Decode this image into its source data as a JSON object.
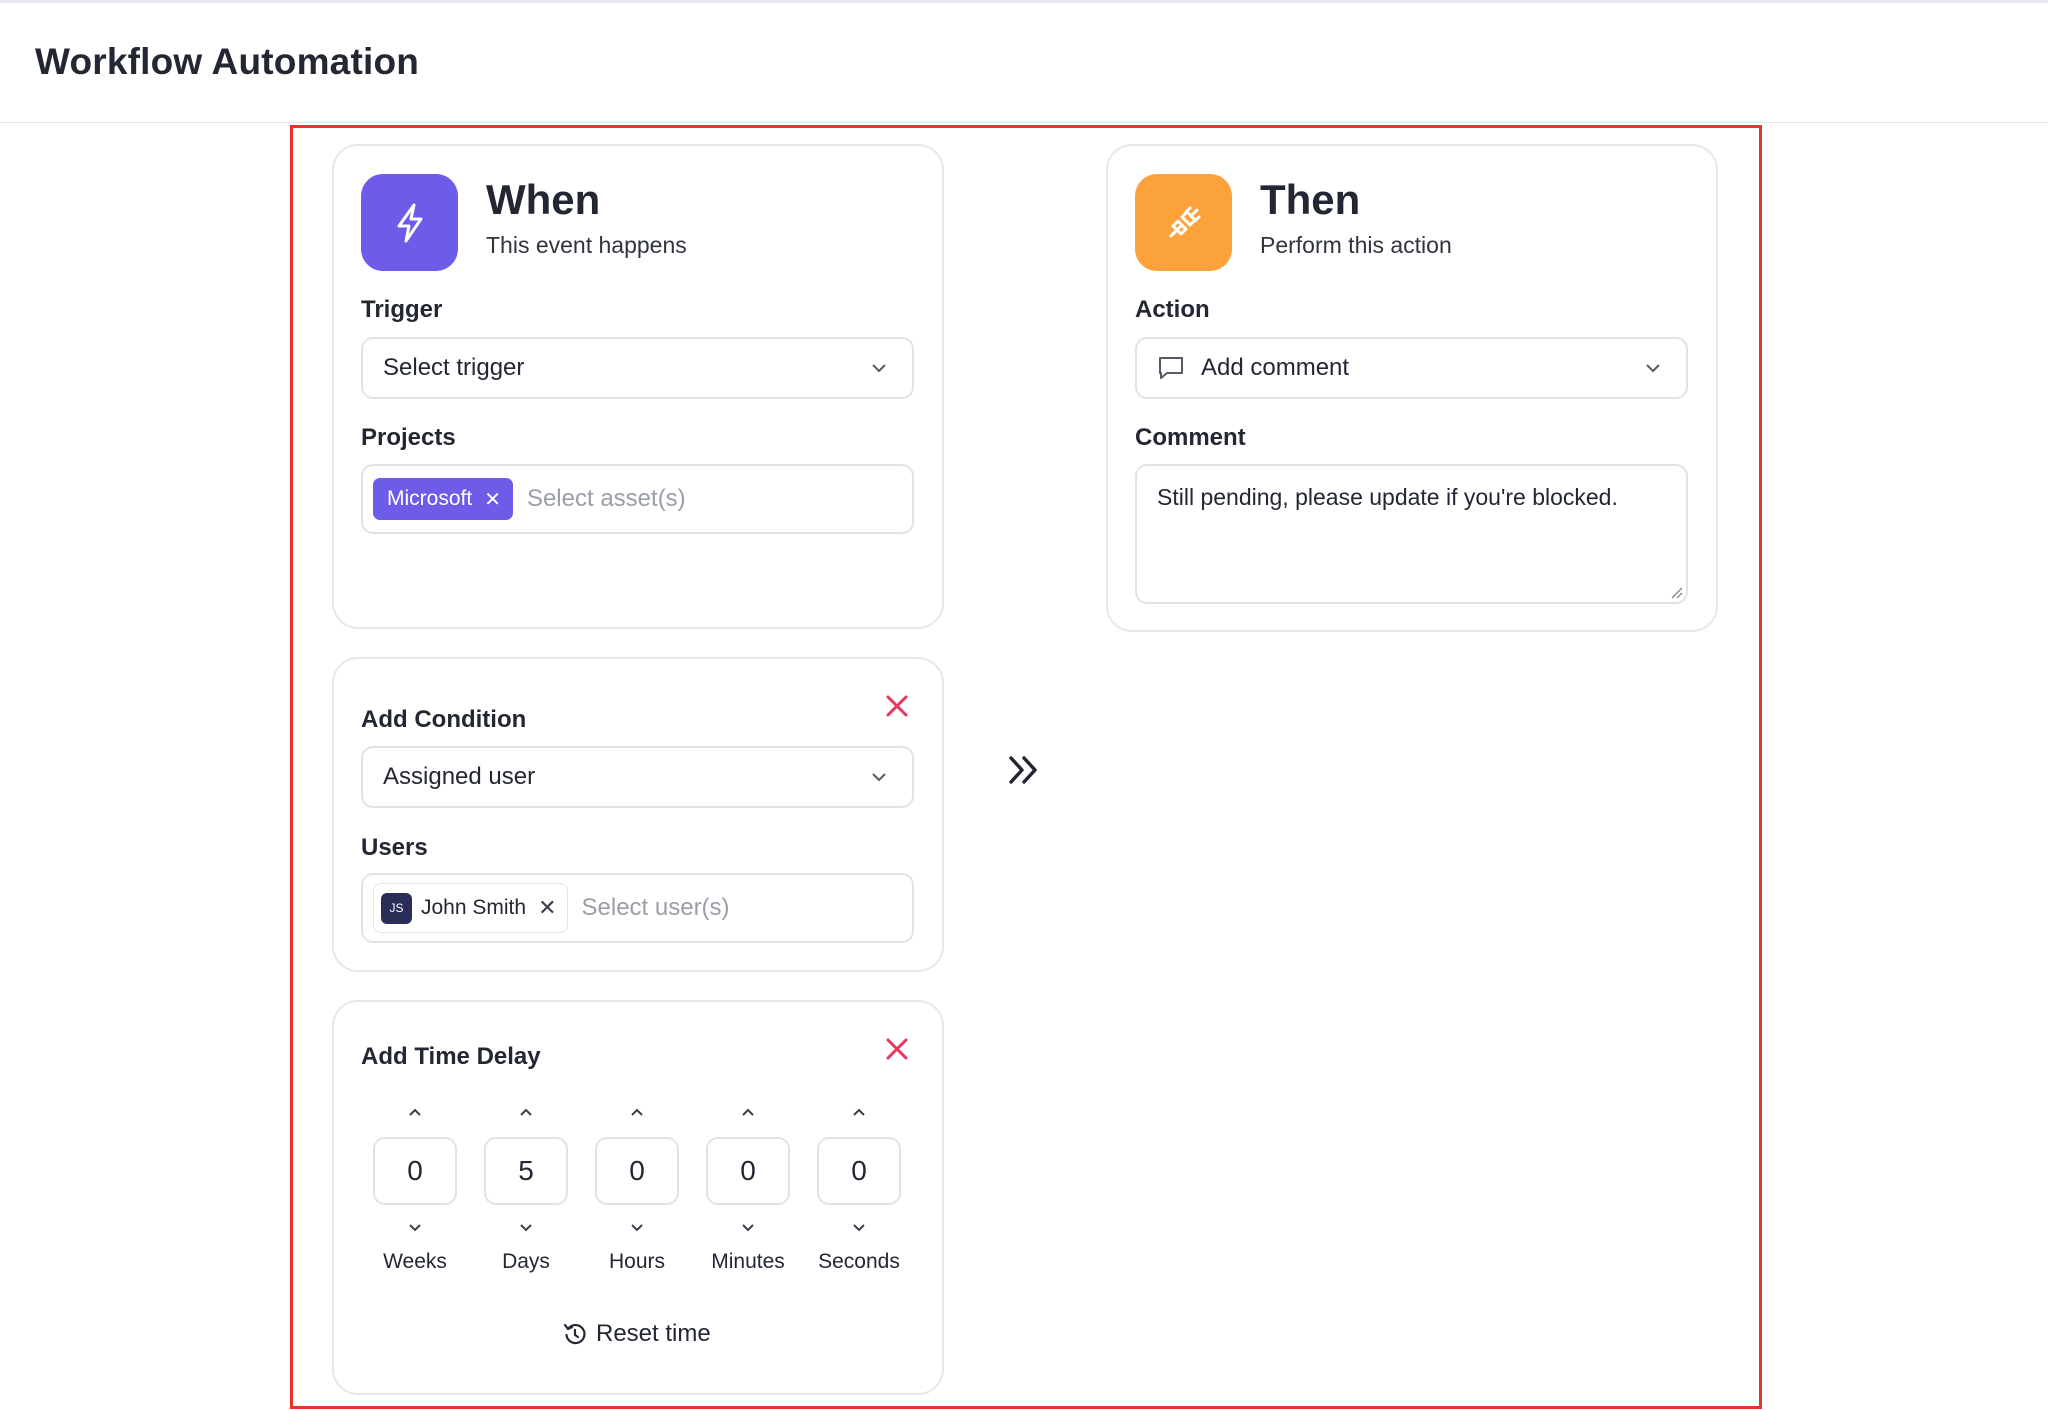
{
  "page": {
    "title": "Workflow Automation"
  },
  "when": {
    "title": "When",
    "subtitle": "This event happens",
    "trigger_label": "Trigger",
    "trigger_value": "Select trigger",
    "projects_label": "Projects",
    "project_tag": "Microsoft",
    "projects_placeholder": "Select asset(s)",
    "icon": "lightning-icon"
  },
  "then": {
    "title": "Then",
    "subtitle": "Perform this action",
    "action_label": "Action",
    "action_value": "Add comment",
    "comment_label": "Comment",
    "comment_value": "Still pending, please update if you're blocked.",
    "icon": "plug-icon"
  },
  "condition": {
    "title": "Add Condition",
    "condition_value": "Assigned user",
    "users_label": "Users",
    "user_tag": {
      "initials": "JS",
      "name": "John Smith"
    },
    "users_placeholder": "Select user(s)"
  },
  "delay": {
    "title": "Add Time Delay",
    "units": [
      {
        "label": "Weeks",
        "value": "0"
      },
      {
        "label": "Days",
        "value": "5"
      },
      {
        "label": "Hours",
        "value": "0"
      },
      {
        "label": "Minutes",
        "value": "0"
      },
      {
        "label": "Seconds",
        "value": "0"
      }
    ],
    "reset_label": "Reset time"
  },
  "colors": {
    "accent_purple": "#6c5ce7",
    "accent_orange": "#fba33a",
    "remove_red": "#e8365d",
    "highlight_red": "#e8322b"
  }
}
